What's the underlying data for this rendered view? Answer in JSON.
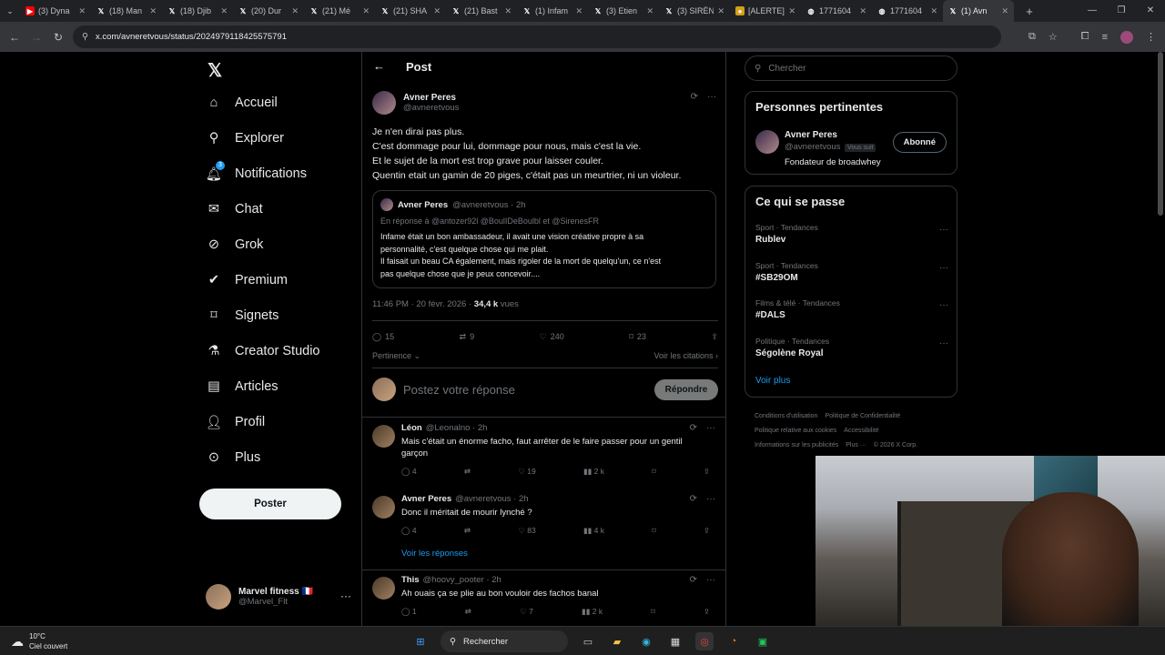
{
  "browser": {
    "tabs": [
      {
        "title": "(3) Dyna",
        "icon": "youtube-icon",
        "color": "#ff0000"
      },
      {
        "title": "(18) Man",
        "icon": "x-icon"
      },
      {
        "title": "(18) Djib",
        "icon": "x-icon"
      },
      {
        "title": "(20) Dur",
        "icon": "x-icon"
      },
      {
        "title": "(21) Mé",
        "icon": "x-icon"
      },
      {
        "title": "(21) SHA",
        "icon": "x-icon"
      },
      {
        "title": "(21) Bast",
        "icon": "x-icon"
      },
      {
        "title": "(1) Infam",
        "icon": "x-icon"
      },
      {
        "title": "(3) Etien",
        "icon": "x-icon"
      },
      {
        "title": "(3) SIRÈN",
        "icon": "x-icon"
      },
      {
        "title": "[ALERTE]",
        "icon": "emoji-icon"
      },
      {
        "title": "1771604",
        "icon": "globe-icon"
      },
      {
        "title": "1771604",
        "icon": "globe-icon"
      },
      {
        "title": "(1) Avn",
        "icon": "x-icon",
        "active": true
      }
    ],
    "url": "x.com/avneretvous/status/2024979118425575791"
  },
  "nav": {
    "items": [
      {
        "label": "Accueil",
        "icon": "home-icon"
      },
      {
        "label": "Explorer",
        "icon": "search-icon"
      },
      {
        "label": "Notifications",
        "icon": "bell-icon",
        "badge": "3"
      },
      {
        "label": "Chat",
        "icon": "mail-icon"
      },
      {
        "label": "Grok",
        "icon": "grok-icon"
      },
      {
        "label": "Premium",
        "icon": "verified-icon"
      },
      {
        "label": "Signets",
        "icon": "bookmark-icon"
      },
      {
        "label": "Creator Studio",
        "icon": "flask-icon"
      },
      {
        "label": "Articles",
        "icon": "article-icon"
      },
      {
        "label": "Profil",
        "icon": "person-icon"
      },
      {
        "label": "Plus",
        "icon": "more-circle-icon"
      }
    ],
    "post_button": "Poster",
    "account": {
      "name": "Marvel fitness 🇫🇷",
      "handle": "@Marvel_Flt"
    }
  },
  "center": {
    "title": "Post",
    "post": {
      "name": "Avner Peres",
      "handle": "@avneretvous",
      "lines": [
        "Je n'en dirai pas plus.",
        "C'est dommage pour lui, dommage pour nous, mais c'est la vie.",
        "Et le sujet de la mort est trop grave pour laisser couler.",
        "Quentin etait un gamin de 20 piges, c'était pas un meurtrier, ni un violeur."
      ],
      "quote": {
        "name": "Avner Peres",
        "sub": "@avneretvous · 2h",
        "reply_to": "En réponse à @antozer92l @BoulIDeBoulbl  et  @SirenesFR",
        "lines": [
          "Infame était un bon ambassadeur, il avait une vision créative propre à sa",
          "personnalité, c'est quelque chose qui me plait.",
          "Il faisait un beau CA également, mais rigoler de la mort de quelqu'un, ce n'est",
          "pas quelque chose que je peux concevoir...."
        ]
      },
      "time": "11:46 PM · 20 févr. 2026 · ",
      "views": "34,4 k",
      "views_label": " vues",
      "stats": {
        "replies": "15",
        "reposts": "9",
        "likes": "240",
        "bookmarks": "23"
      },
      "sort_label": "Pertinence",
      "citations_label": "Voir les citations"
    },
    "reply_placeholder": "Postez votre réponse",
    "reply_button": "Répondre",
    "replies": [
      {
        "name": "Léon",
        "handle": "@Leonalno · 2h",
        "lines": [
          "Mais c'était un énorme facho, faut arrêter de le faire passer pour un gentil",
          "garçon"
        ],
        "stats": {
          "replies": "4",
          "reposts": "",
          "likes": "19",
          "views": "2 k"
        }
      },
      {
        "name": "Avner Peres",
        "handle": "@avneretvous · 2h",
        "lines": [
          "Donc il méritait de mourir lynché ?"
        ],
        "stats": {
          "replies": "4",
          "reposts": "",
          "likes": "83",
          "views": "4 k"
        },
        "more": "Voir les réponses"
      },
      {
        "name": "This",
        "handle": "@hoovy_pooter · 2h",
        "lines": [
          "Ah ouais ça se plie au bon vouloir des fachos banal"
        ],
        "stats": {
          "replies": "1",
          "reposts": "",
          "likes": "7",
          "views": "2 k"
        }
      }
    ]
  },
  "right": {
    "search_placeholder": "Chercher",
    "relevant": {
      "title": "Personnes pertinentes",
      "name": "Avner Peres",
      "handle": "@avneretvous",
      "follows_you": "Vous suit",
      "bio": "Fondateur de broadwhey",
      "follow_label": "Abonné"
    },
    "trends": {
      "title": "Ce qui se passe",
      "items": [
        {
          "category": "Sport · Tendances",
          "name": "Rublev"
        },
        {
          "category": "Sport · Tendances",
          "name": "#SB29OM"
        },
        {
          "category": "Films & télé · Tendances",
          "name": "#DALS"
        },
        {
          "category": "Politique · Tendances",
          "name": "Ségolène Royal"
        }
      ],
      "more": "Voir plus"
    },
    "footer": [
      "Conditions d'utilisation",
      "Politique de Confidentialité",
      "Politique relative aux cookies",
      "Accessibilité",
      "Informations sur les publicités",
      "Plus ···",
      "© 2026 X Corp."
    ]
  },
  "taskbar": {
    "temp": "10°C",
    "weather": "Ciel couvert",
    "search": "Rechercher"
  }
}
